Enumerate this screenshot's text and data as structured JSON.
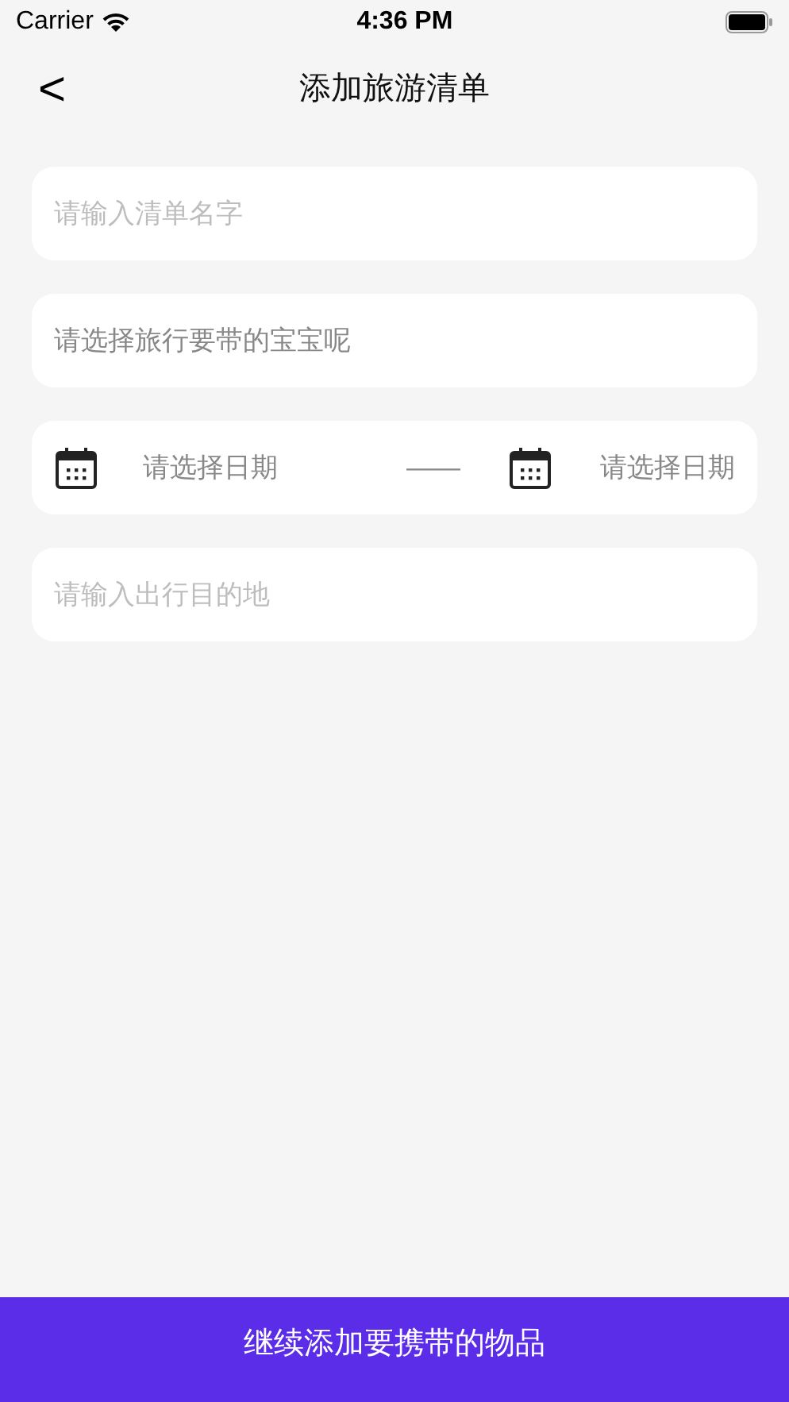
{
  "status_bar": {
    "carrier": "Carrier",
    "time": "4:36 PM"
  },
  "nav": {
    "back": "<",
    "title": "添加旅游清单"
  },
  "form": {
    "name_field": {
      "placeholder": "请输入清单名字"
    },
    "baby_select": {
      "label": "请选择旅行要带的宝宝呢"
    },
    "date_range": {
      "start": "请选择日期",
      "separator": "——",
      "end": "请选择日期"
    },
    "destination_field": {
      "placeholder": "请输入出行目的地"
    }
  },
  "continue_button": "继续添加要携带的物品"
}
